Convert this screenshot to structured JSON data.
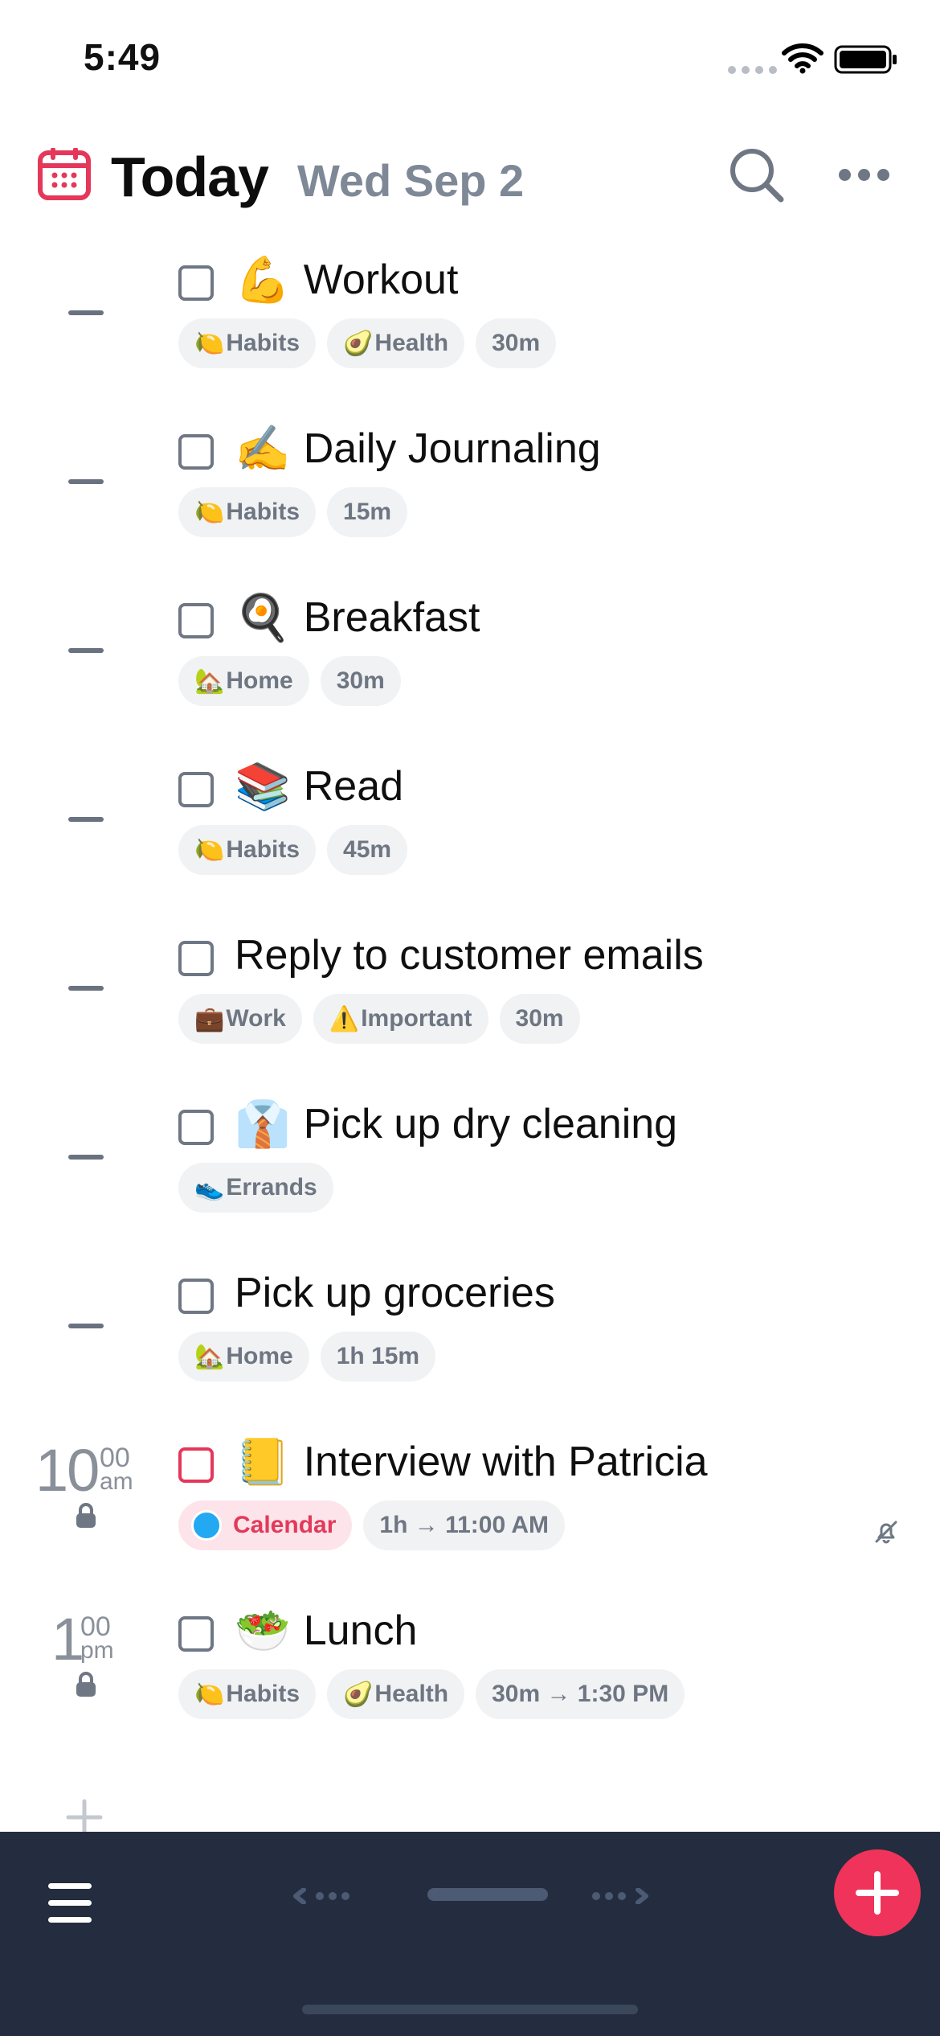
{
  "status_bar": {
    "time": "5:49"
  },
  "header": {
    "title": "Today",
    "date": "Wed Sep 2"
  },
  "tasks": [
    {
      "emoji": "💪",
      "title": "Workout",
      "tags": [
        {
          "emoji": "🍋",
          "label": "Habits"
        },
        {
          "emoji": "🥑",
          "label": "Health"
        },
        {
          "emoji": "",
          "label": "30m"
        }
      ]
    },
    {
      "emoji": "✍️",
      "title": "Daily Journaling",
      "tags": [
        {
          "emoji": "🍋",
          "label": "Habits"
        },
        {
          "emoji": "",
          "label": "15m"
        }
      ]
    },
    {
      "emoji": "🍳",
      "title": "Breakfast",
      "tags": [
        {
          "emoji": "🏡",
          "label": "Home"
        },
        {
          "emoji": "",
          "label": "30m"
        }
      ]
    },
    {
      "emoji": "📚",
      "title": "Read",
      "tags": [
        {
          "emoji": "🍋",
          "label": "Habits"
        },
        {
          "emoji": "",
          "label": "45m"
        }
      ]
    },
    {
      "emoji": "",
      "title": "Reply to customer emails",
      "tags": [
        {
          "emoji": "💼",
          "label": "Work"
        },
        {
          "emoji": "⚠️",
          "label": "Important"
        },
        {
          "emoji": "",
          "label": "30m"
        }
      ]
    },
    {
      "emoji": "👔",
      "title": "Pick up dry cleaning",
      "tags": [
        {
          "emoji": "👟",
          "label": "Errands"
        }
      ]
    },
    {
      "emoji": "",
      "title": "Pick up groceries",
      "tags": [
        {
          "emoji": "🏡",
          "label": "Home"
        },
        {
          "emoji": "",
          "label": "1h 15m"
        }
      ]
    },
    {
      "emoji": "📒",
      "title": "Interview with Patricia",
      "time": {
        "hour": "10",
        "min": "00",
        "ampm": "am"
      },
      "tags": [
        {
          "emoji": "",
          "label": "Calendar",
          "type": "calendar"
        },
        {
          "emoji": "",
          "label": "1h → 11:00 AM"
        }
      ]
    },
    {
      "emoji": "🥗",
      "title": "Lunch",
      "time": {
        "hour": "1",
        "min": "00",
        "ampm": "pm"
      },
      "tags": [
        {
          "emoji": "🍋",
          "label": "Habits"
        },
        {
          "emoji": "🥑",
          "label": "Health"
        },
        {
          "emoji": "",
          "label": "30m → 1:30 PM"
        }
      ]
    }
  ],
  "colors": {
    "accent": "#f0335a",
    "bottom_bar": "#232d3f",
    "calendar_dot": "#23a8f2"
  }
}
